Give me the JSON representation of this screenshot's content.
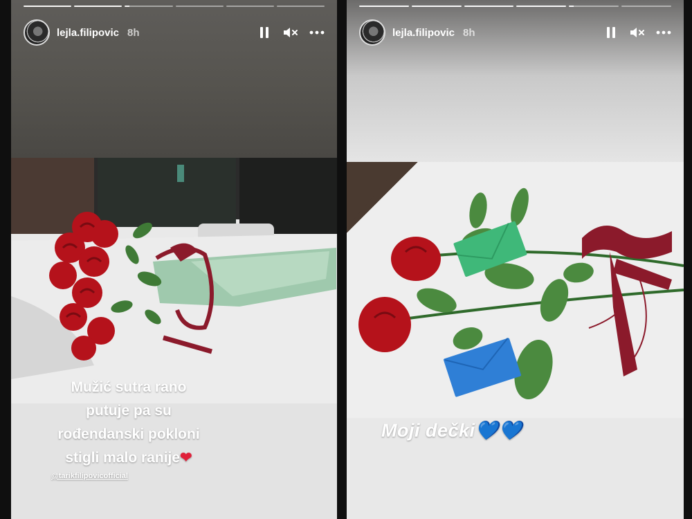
{
  "stories": [
    {
      "username": "lejla.filipovic",
      "time": "8h",
      "caption_lines": [
        "Mužić sutra rano",
        "putuje pa su",
        "rođendanski pokloni",
        "stigli malo ranije"
      ],
      "caption_emoji": "❤",
      "mention": "@tarikfilipovicofficial",
      "progress": {
        "segments": 6,
        "current": 3,
        "current_fill": 0.1
      }
    },
    {
      "username": "lejla.filipovic",
      "time": "8h",
      "caption": "Moji dečki",
      "caption_emoji": "💙💙",
      "progress": {
        "segments": 6,
        "current": 4,
        "current_fill": 0.1
      }
    }
  ],
  "icons": {
    "pause": "pause-icon",
    "mute": "muted-speaker-icon",
    "more": "more-dots-icon"
  },
  "colors": {
    "rose": "#b5121b",
    "ribbon": "#8b1a2b",
    "envelope_green": "#3fb879",
    "envelope_blue": "#2f7fd6"
  }
}
